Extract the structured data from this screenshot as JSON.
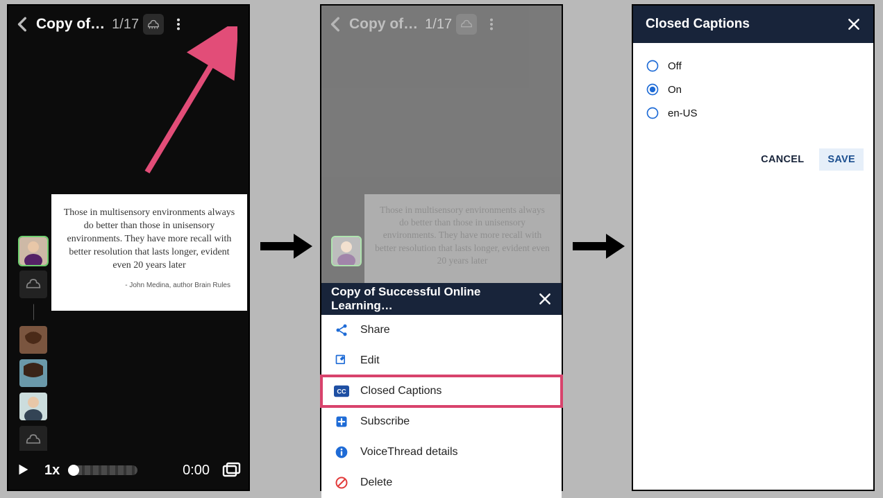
{
  "panel1": {
    "title": "Copy of…",
    "counter": "1/17",
    "slide_text": "Those in multisensory environments always do better than those in unisensory environments. They have more recall with better resolution that lasts longer, evident even 20 years later",
    "slide_credit": "- John Medina, author Brain Rules",
    "speed": "1x",
    "time": "0:00"
  },
  "panel2": {
    "title": "Copy of…",
    "counter": "1/17",
    "slide_text": "Those in multisensory environments always do better than those in unisensory environments. They have more recall with better resolution that lasts longer, evident even 20 years later",
    "menu_title": "Copy of Successful Online Learning…",
    "items": [
      {
        "icon": "share-icon",
        "label": "Share"
      },
      {
        "icon": "edit-icon",
        "label": "Edit"
      },
      {
        "icon": "cc-icon",
        "label": "Closed Captions"
      },
      {
        "icon": "subscribe-icon",
        "label": "Subscribe"
      },
      {
        "icon": "info-icon",
        "label": "VoiceThread details"
      },
      {
        "icon": "delete-icon",
        "label": "Delete"
      }
    ]
  },
  "panel3": {
    "title": "Closed Captions",
    "options": [
      "Off",
      "On",
      "en-US"
    ],
    "selected": "On",
    "cancel": "CANCEL",
    "save": "SAVE"
  }
}
